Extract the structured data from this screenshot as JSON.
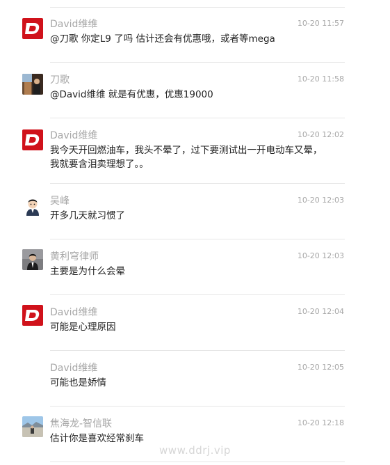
{
  "comments": [
    {
      "author": "David维维",
      "time": "10-20 11:57",
      "text": "@刀歌 你定L9 了吗 估计还会有优惠哦，或者等mega",
      "avatar_icon": "dongchedi-logo-icon"
    },
    {
      "author": "刀歌",
      "time": "10-20 11:58",
      "text": "@David维维 就是有优惠，优惠19000",
      "avatar_icon": "user-photo-avatar"
    },
    {
      "author": "David维维",
      "time": "10-20 12:02",
      "text": "我今天开回燃油车，我头不晕了，过下要测试出一开电动车又晕，我就要含泪卖理想了。。",
      "avatar_icon": "dongchedi-logo-icon"
    },
    {
      "author": "吴峰",
      "time": "10-20 12:03",
      "text": "开多几天就习惯了",
      "avatar_icon": "cartoon-man-avatar"
    },
    {
      "author": "黄利穹律师",
      "time": "10-20 12:03",
      "text": "主要是为什么会晕",
      "avatar_icon": "lawyer-photo-avatar"
    },
    {
      "author": "David维维",
      "time": "10-20 12:04",
      "text": "可能是心理原因",
      "avatar_icon": "dongchedi-logo-icon"
    },
    {
      "author": "David维维",
      "time": "10-20 12:05",
      "text": "可能也是娇情",
      "avatar_icon": "none"
    },
    {
      "author": "焦海龙-智信联",
      "time": "10-20 12:18",
      "text": "估计你是喜欢经常刹车",
      "avatar_icon": "landscape-photo-avatar"
    }
  ],
  "watermark": "www.ddrj.vip",
  "colors": {
    "brand_red": "#d0121b",
    "meta_gray": "#a6a6a6",
    "text": "#222222",
    "divider": "#e6e6e6"
  }
}
